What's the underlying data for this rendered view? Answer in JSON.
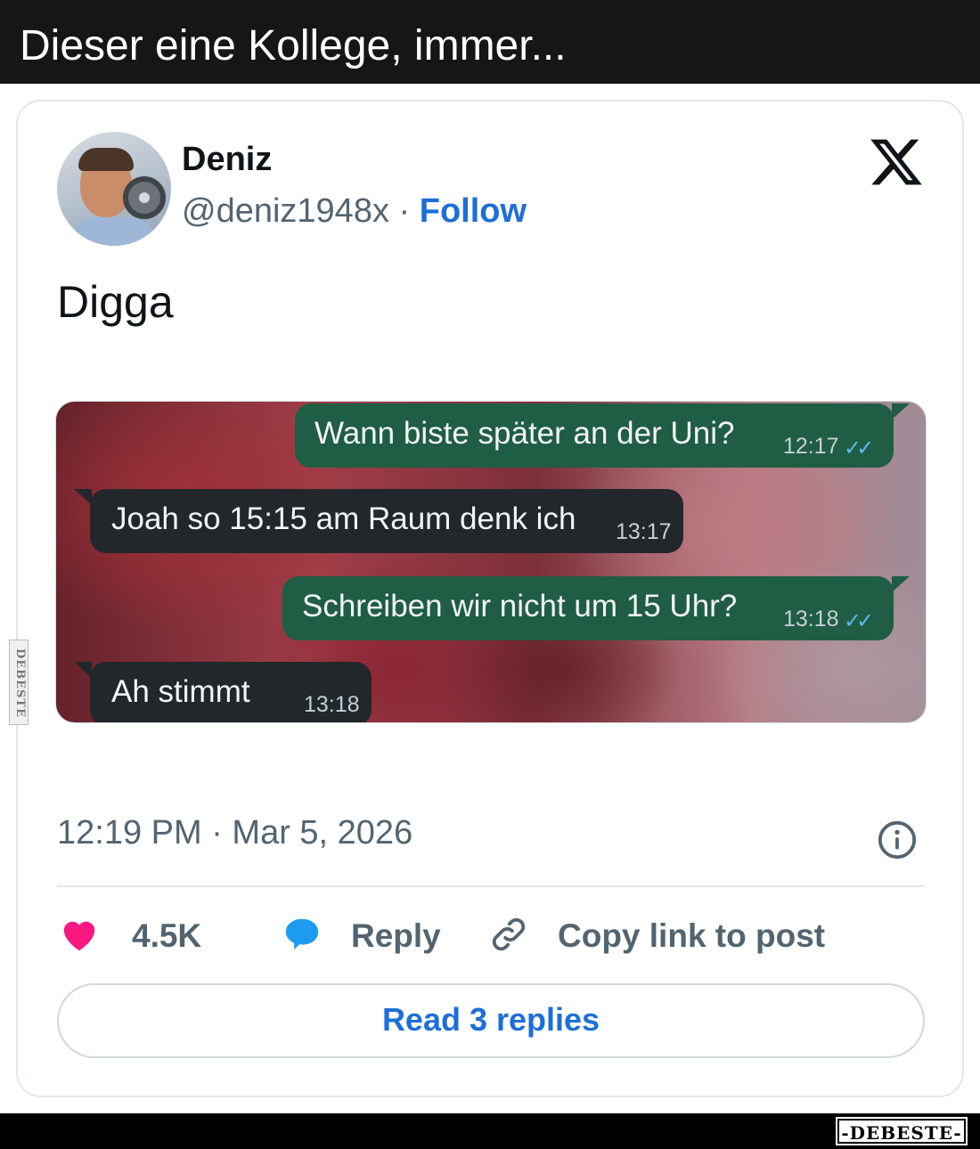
{
  "caption": "Dieser eine Kollege, immer...",
  "post": {
    "author": {
      "name": "Deniz",
      "handle": "@deniz1948x",
      "separator": "·",
      "follow_label": "Follow"
    },
    "text": "Digga",
    "chat": [
      {
        "direction": "outgoing",
        "text": "Wann biste später an der Uni?",
        "time": "12:17",
        "read_ticks": "✓✓"
      },
      {
        "direction": "incoming",
        "text": "Joah so 15:15 am Raum denk ich",
        "time": "13:17"
      },
      {
        "direction": "outgoing",
        "text": "Schreiben wir nicht um 15 Uhr?",
        "time": "13:18",
        "read_ticks": "✓✓"
      },
      {
        "direction": "incoming",
        "text": "Ah stimmt",
        "time": "13:18"
      }
    ],
    "timestamp": "12:19 PM · Mar 5, 2026",
    "actions": {
      "likes": "4.5K",
      "reply_label": "Reply",
      "copy_link_label": "Copy link to post"
    },
    "read_replies_label": "Read 3 replies"
  },
  "watermark_side": "DEBESTE",
  "watermark_logo": "-DEBESTE-",
  "colors": {
    "follow_blue": "#1d6fd8",
    "heart_pink": "#f91880",
    "reply_blue": "#1d9bf0",
    "outgoing_bubble": "#1f5d45",
    "incoming_bubble": "#22272b"
  },
  "icons": {
    "brand": "x-logo-icon",
    "info": "info-icon",
    "like": "heart-icon",
    "reply": "speech-bubble-icon",
    "copy_link": "link-icon"
  }
}
